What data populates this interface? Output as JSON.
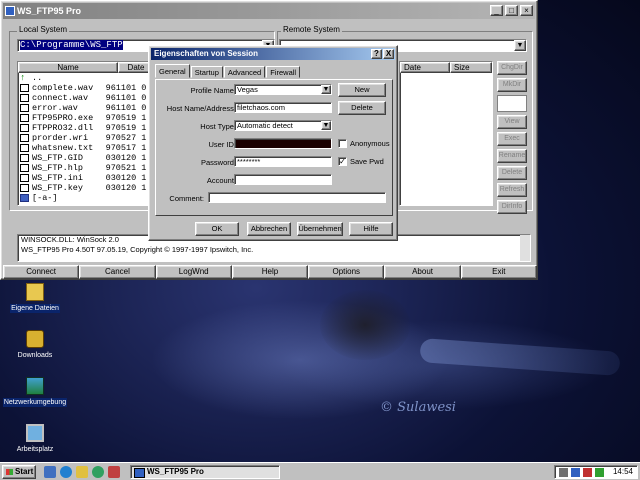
{
  "app": {
    "title": "WS_FTP95 Pro",
    "local_label": "Local System",
    "remote_label": "Remote System",
    "local_path": "C:\\Programme\\WS_FTP",
    "remote_path": "",
    "local_columns": [
      "Name",
      "Date"
    ],
    "remote_columns": [
      "Date",
      "Size"
    ],
    "local_files": [
      {
        "name": "..",
        "date": "",
        "icon": "up-arrow-icon"
      },
      {
        "name": "complete.wav",
        "date": "961101 0",
        "icon": "file-icon"
      },
      {
        "name": "connect.wav",
        "date": "961101 0",
        "icon": "file-icon"
      },
      {
        "name": "error.wav",
        "date": "961101 0",
        "icon": "file-icon"
      },
      {
        "name": "FTP95PRO.exe",
        "date": "970519 1",
        "icon": "file-icon"
      },
      {
        "name": "FTPPRO32.dll",
        "date": "970519 1",
        "icon": "file-icon"
      },
      {
        "name": "prorder.wri",
        "date": "970527 1",
        "icon": "file-icon"
      },
      {
        "name": "whatsnew.txt",
        "date": "970517 1",
        "icon": "file-icon"
      },
      {
        "name": "WS_FTP.GID",
        "date": "030120 1",
        "icon": "file-icon"
      },
      {
        "name": "WS_FTP.hlp",
        "date": "970521 1",
        "icon": "file-icon"
      },
      {
        "name": "WS_FTP.ini",
        "date": "030120 1",
        "icon": "file-icon"
      },
      {
        "name": "WS_FTP.key",
        "date": "030120 1",
        "icon": "file-icon"
      },
      {
        "name": "[-a-]",
        "date": "",
        "icon": "drive-icon"
      }
    ],
    "side_buttons": [
      "ChgDir",
      "MkDir",
      "",
      "View",
      "Exec",
      "Rename",
      "Delete",
      "Refresh",
      "DirInfo"
    ],
    "log_lines": [
      "WINSOCK.DLL: WinSock 2.0",
      "WS_FTP95 Pro 4.50T 97.05.19, Copyright © 1997-1997 Ipswitch, Inc."
    ],
    "bottom_buttons": [
      "Connect",
      "Cancel",
      "LogWnd",
      "Help",
      "Options",
      "About",
      "Exit"
    ]
  },
  "dialog": {
    "title": "Eigenschaften von Session",
    "help_btn": "?",
    "close_btn": "X",
    "tabs": [
      "General",
      "Startup",
      "Advanced",
      "Firewall"
    ],
    "labels": {
      "profile": "Profile Name:",
      "host": "Host Name/Address:",
      "host_type": "Host Type:",
      "user_id": "User ID:",
      "password": "Password:",
      "account": "Account:",
      "comment": "Comment:"
    },
    "values": {
      "profile": "Vegas",
      "host": "filetchaos.com",
      "host_type": "Automatic detect",
      "user_id": "",
      "password": "********",
      "account": "",
      "comment": ""
    },
    "new_btn": "New",
    "delete_btn": "Delete",
    "anonymous": {
      "label": "Anonymous",
      "checked": false
    },
    "save_pwd": {
      "label": "Save Pwd",
      "checked": true
    },
    "footer_buttons": [
      "OK",
      "Abbrechen",
      "Übernehmen",
      "Hilfe"
    ]
  },
  "desktop_icons": [
    {
      "label": "Eigene Dateien",
      "icon": "folder-icon",
      "selected": true
    },
    {
      "label": "Downloads",
      "icon": "downloads-icon",
      "selected": false
    },
    {
      "label": "Netzwerkumgebung",
      "icon": "network-icon",
      "selected": true
    },
    {
      "label": "Arbeitsplatz",
      "icon": "computer-icon",
      "selected": false
    }
  ],
  "wallpaper_signature": "© Sulawesi",
  "taskbar": {
    "start": "Start",
    "task_label": "WS_FTP95 Pro",
    "clock": "14:54"
  }
}
